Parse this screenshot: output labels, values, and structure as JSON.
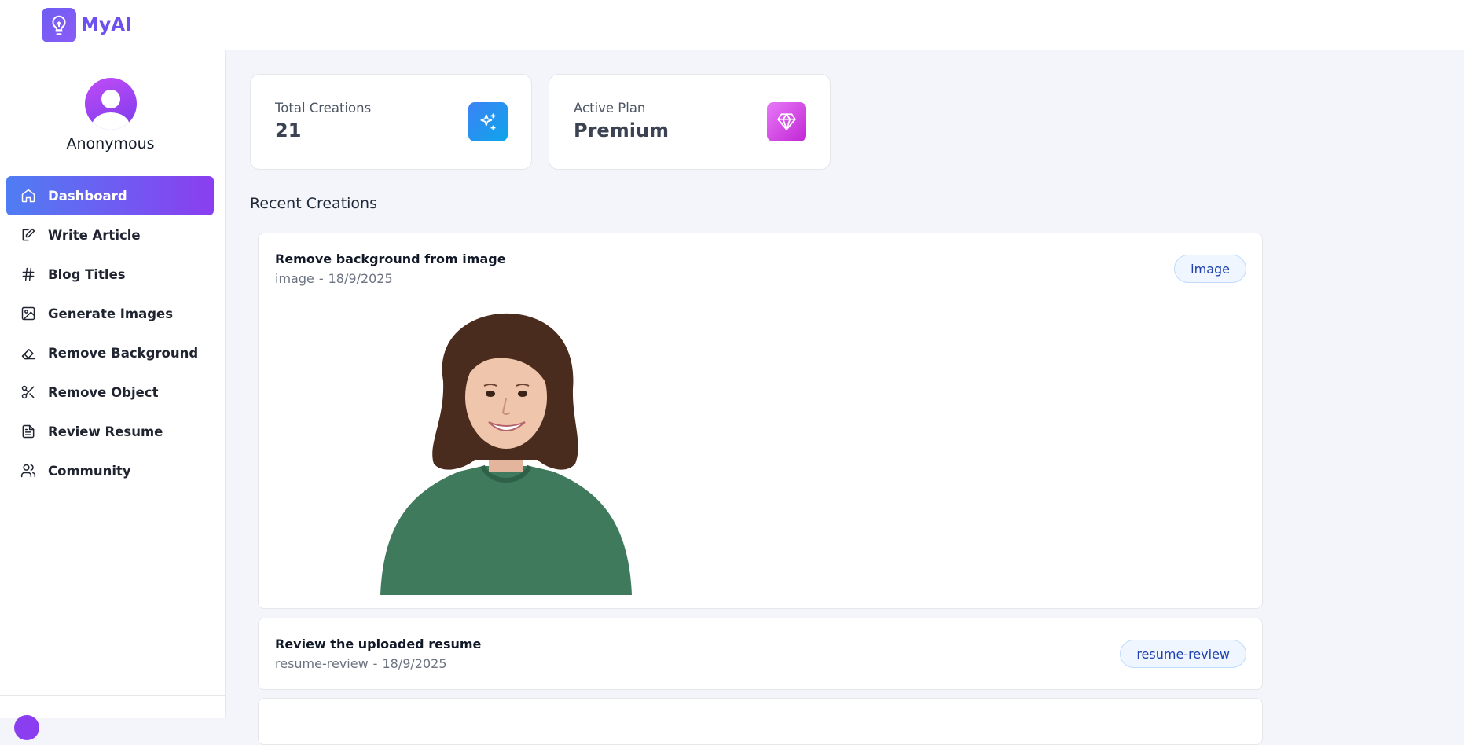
{
  "app": {
    "name": "MyAI"
  },
  "user": {
    "name": "Anonymous"
  },
  "sidebar": {
    "items": [
      {
        "label": "Dashboard",
        "icon": "home-icon",
        "active": true
      },
      {
        "label": "Write Article",
        "icon": "edit-icon"
      },
      {
        "label": "Blog Titles",
        "icon": "hash-icon"
      },
      {
        "label": "Generate Images",
        "icon": "image-icon"
      },
      {
        "label": "Remove Background",
        "icon": "eraser-icon"
      },
      {
        "label": "Remove Object",
        "icon": "scissors-icon"
      },
      {
        "label": "Review Resume",
        "icon": "file-text-icon"
      },
      {
        "label": "Community",
        "icon": "users-icon"
      }
    ]
  },
  "stats": {
    "total": {
      "label": "Total Creations",
      "value": "21",
      "icon": "sparkles-icon",
      "color": "#0ea5e9"
    },
    "plan": {
      "label": "Active Plan",
      "value": "Premium",
      "icon": "gem-icon",
      "color": "#d946ef"
    }
  },
  "recent": {
    "title": "Recent Creations",
    "items": [
      {
        "title": "Remove background from image",
        "type": "image",
        "date": "18/9/2025",
        "badge": "image"
      },
      {
        "title": "Review the uploaded resume",
        "type": "resume-review",
        "date": "18/9/2025",
        "badge": "resume-review"
      }
    ]
  },
  "colors": {
    "accent_start": "#4f7df3",
    "accent_end": "#8b3ef0",
    "brand": "#6d4ff0"
  }
}
